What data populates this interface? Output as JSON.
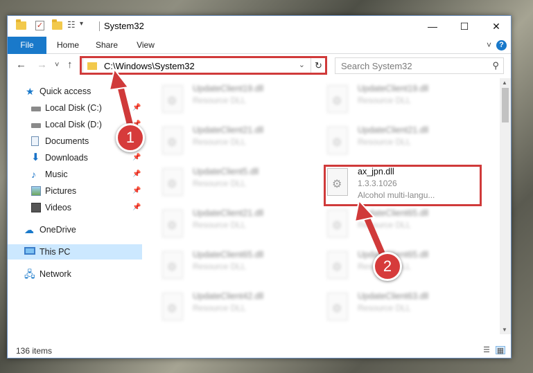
{
  "window": {
    "title": "System32",
    "controls": {
      "minimize": "—",
      "maximize": "☐",
      "close": "✕"
    },
    "quick_access_toolbar": [
      "folder-icon",
      "properties-check-icon",
      "new-folder-icon",
      "properties-icon",
      "customize-dropdown-icon"
    ]
  },
  "ribbon": {
    "tabs": [
      {
        "label": "File",
        "active": true
      },
      {
        "label": "Home"
      },
      {
        "label": "Share"
      },
      {
        "label": "View"
      }
    ],
    "help_icon": "?"
  },
  "navigation": {
    "back": "←",
    "forward": "→",
    "recent": "˅",
    "up": "↑",
    "address": "C:\\Windows\\System32",
    "search_placeholder": "Search System32"
  },
  "sidebar": {
    "items": [
      {
        "label": "Quick access",
        "icon": "star-icon"
      },
      {
        "label": "Local Disk (C:)",
        "icon": "drive-icon",
        "pinned": true
      },
      {
        "label": "Local Disk (D:)",
        "icon": "drive-icon",
        "pinned": true
      },
      {
        "label": "Documents",
        "icon": "documents-icon",
        "pinned": true
      },
      {
        "label": "Downloads",
        "icon": "downloads-icon",
        "pinned": true
      },
      {
        "label": "Music",
        "icon": "music-icon",
        "pinned": true
      },
      {
        "label": "Pictures",
        "icon": "pictures-icon",
        "pinned": true
      },
      {
        "label": "Videos",
        "icon": "videos-icon",
        "pinned": true
      },
      {
        "label": "OneDrive",
        "icon": "onedrive-icon"
      },
      {
        "label": "This PC",
        "icon": "this-pc-icon",
        "selected": true
      },
      {
        "label": "Network",
        "icon": "network-icon"
      }
    ]
  },
  "files": {
    "left_column": [
      {
        "name": "UpdateClient19.dll",
        "desc": "Resource DLL"
      },
      {
        "name": "UpdateClient21.dll",
        "desc": "Resource DLL"
      },
      {
        "name": "UpdateClient5.dll",
        "desc": "Resource DLL"
      },
      {
        "name": "UpdateClient21.dll",
        "desc": "Resource DLL"
      },
      {
        "name": "UpdateClient65.dll",
        "desc": "Resource DLL"
      },
      {
        "name": "UpdateClient42.dll",
        "desc": "Resource DLL"
      }
    ],
    "right_column": [
      {
        "name": "UpdateClient19.dll",
        "desc": "Resource DLL"
      },
      {
        "name": "UpdateClient21.dll",
        "desc": "Resource DLL"
      },
      {
        "name": "UpdateClient65.dll",
        "desc": "Resource DLL"
      },
      {
        "name": "UpdateClient65.dll",
        "desc": "Resource DLL"
      },
      {
        "name": "UpdateClient63.dll",
        "desc": "Resource DLL"
      }
    ],
    "highlighted": {
      "name": "ax_jpn.dll",
      "version": "1.3.3.1026",
      "desc": "Alcohol multi-langu..."
    }
  },
  "status": {
    "item_count": "136 items"
  },
  "annotations": {
    "step1": "1",
    "step2": "2",
    "color": "#d03a3a"
  }
}
